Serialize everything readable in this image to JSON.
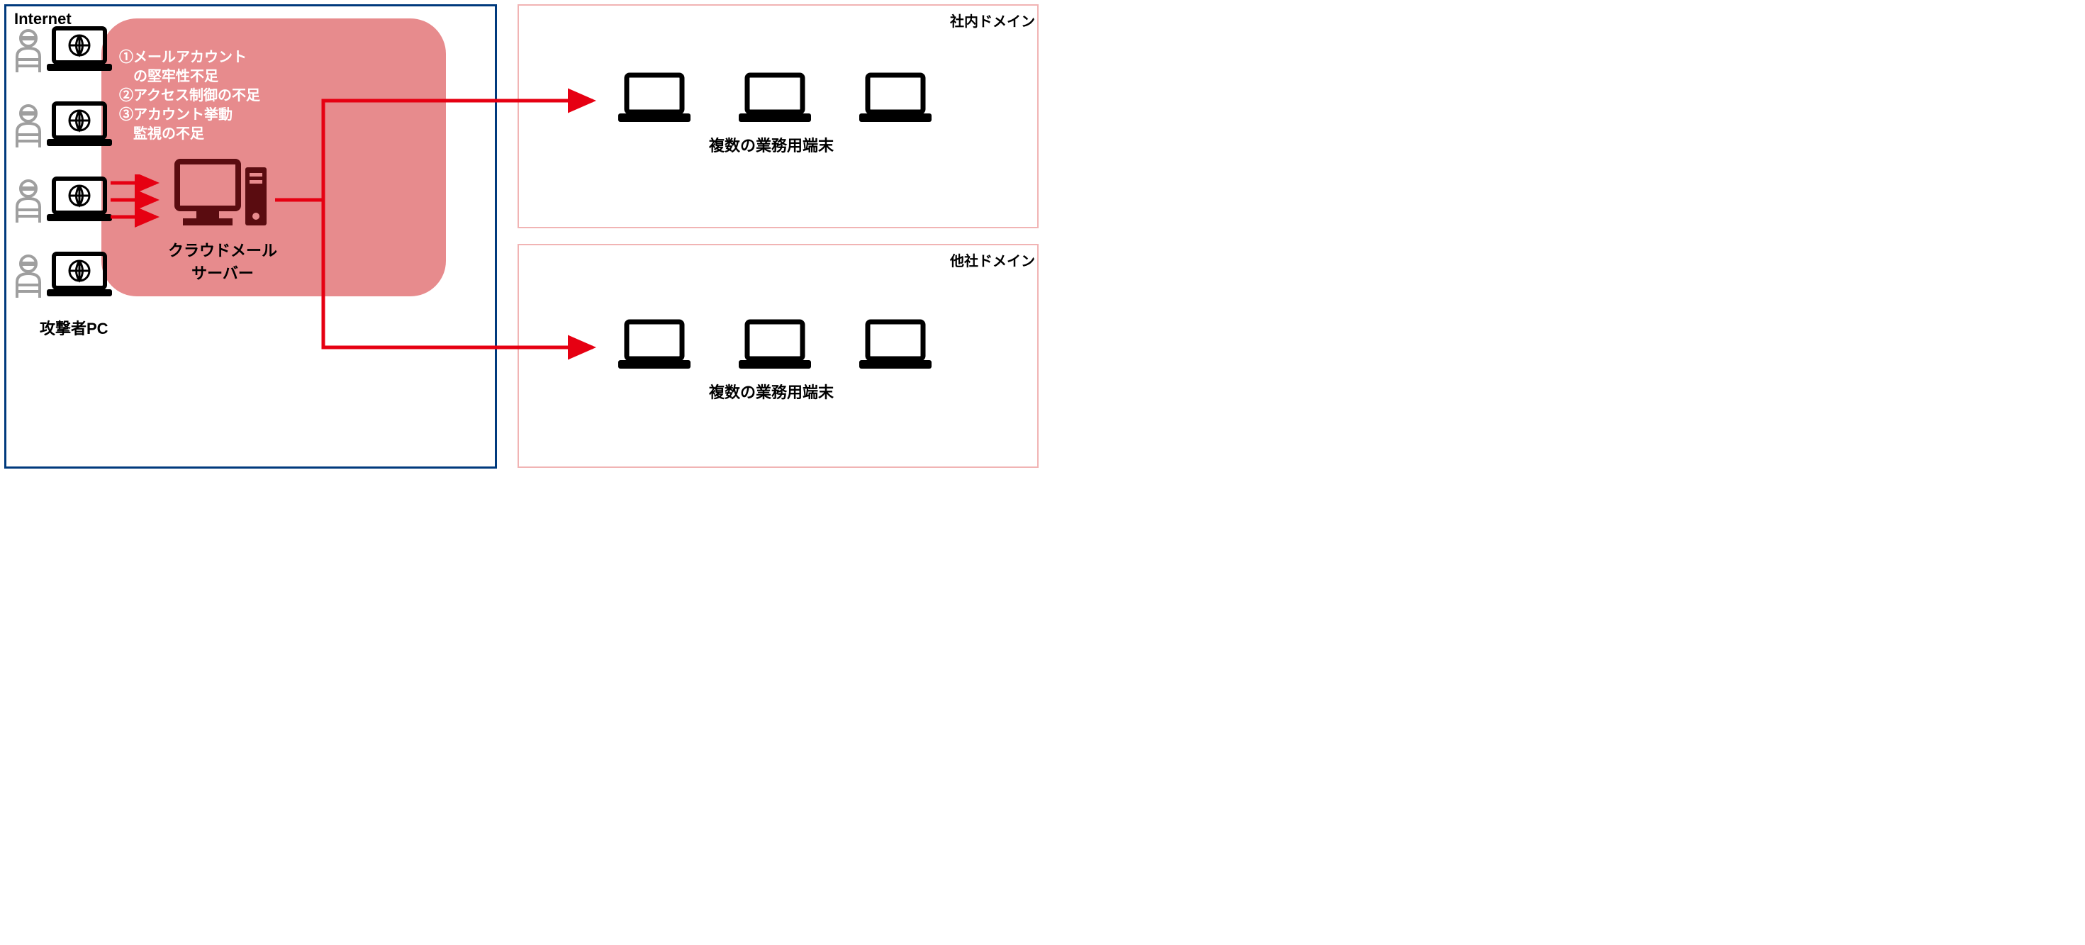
{
  "zones": {
    "internet": "Internet",
    "internal": "社内ドメイン",
    "external": "他社ドメイン"
  },
  "labels": {
    "attacker": "攻撃者PC",
    "cloud_server": "クラウドメール\nサーバー",
    "business_terminals": "複数の業務用端末"
  },
  "issues": {
    "line1": "①メールアカウント",
    "line2": "　の堅牢性不足",
    "line3": "②アクセス制御の不足",
    "line4": "③アカウント挙動",
    "line5": "　監視の不足"
  },
  "colors": {
    "attack_red": "#e60012",
    "dark_red": "#5a0c10",
    "blob": "#e78b8d",
    "internet_border": "#003a7d",
    "domain_border": "#f1b4b4",
    "attacker_grey": "#9f9f9f"
  }
}
